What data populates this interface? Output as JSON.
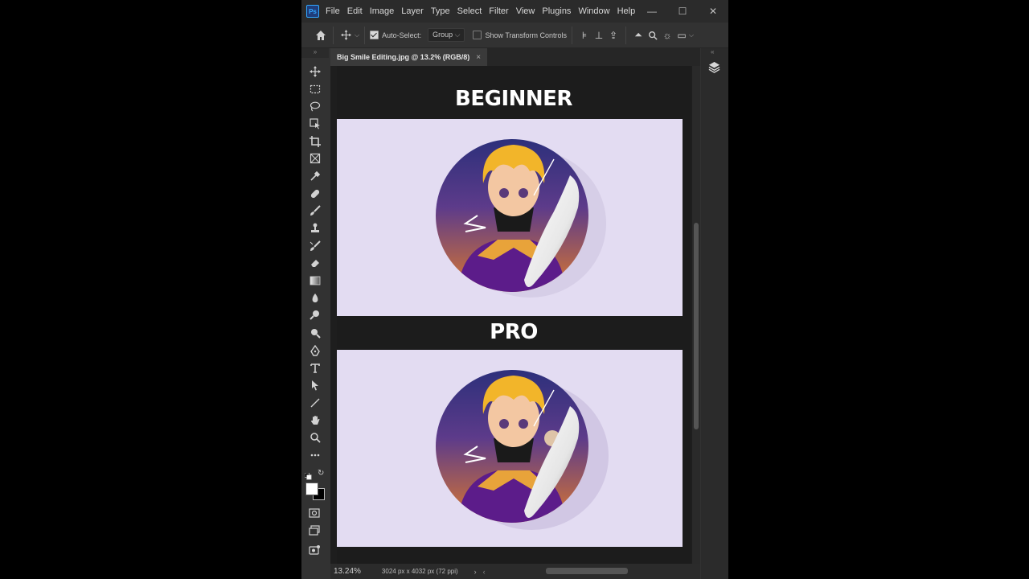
{
  "app": {
    "logo_text": "Ps"
  },
  "menu": [
    "File",
    "Edit",
    "Image",
    "Layer",
    "Type",
    "Select",
    "Filter",
    "View",
    "Plugins",
    "Window",
    "Help"
  ],
  "window_controls": {
    "minimize": "—",
    "maximize": "☐",
    "close": "✕"
  },
  "options_bar": {
    "auto_select_label": "Auto-Select:",
    "auto_select_checked": true,
    "group_value": "Group",
    "show_transform_label": "Show Transform Controls",
    "show_transform_checked": false
  },
  "tab": {
    "title": "Big Smile Editing.jpg @ 13.2% (RGB/8)",
    "close": "×"
  },
  "canvas": {
    "top_heading": "BEGINNER",
    "bottom_heading": "PRO",
    "panel_bg": "#e3dcf2"
  },
  "status": {
    "zoom": "13.24%",
    "dimensions": "3024 px x 4032 px (72 ppi)",
    "arrow": "›"
  },
  "tools": [
    "move-tool",
    "marquee-tool",
    "lasso-tool",
    "object-select-tool",
    "crop-tool",
    "frame-tool",
    "eyedropper-tool",
    "healing-brush-tool",
    "brush-tool",
    "clone-stamp-tool",
    "history-brush-tool",
    "eraser-tool",
    "gradient-tool",
    "blur-tool",
    "dodge-tool",
    "pen-tool",
    "type-tool",
    "path-select-tool",
    "line-tool",
    "hand-tool",
    "zoom-tool",
    "more-tools"
  ],
  "colors": {
    "accent": "#31a8ff",
    "chrome": "#323232",
    "dark": "#1e1e1e"
  }
}
